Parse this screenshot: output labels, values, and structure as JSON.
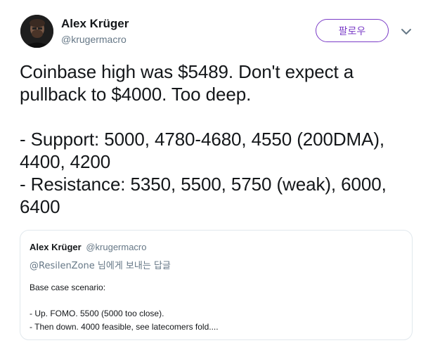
{
  "author": {
    "name": "Alex Krüger",
    "handle": "@krugermacro"
  },
  "follow_button": {
    "label": "팔로우"
  },
  "tweet": {
    "lines": [
      "Coinbase high was $5489. Don't expect a",
      "pullback to $4000. Too deep.",
      "",
      "- Support: 5000, 4780-4680, 4550 (200DMA),",
      "4400, 4200",
      "- Resistance: 5350, 5500, 5750 (weak), 6000,",
      "6400"
    ]
  },
  "quoted_tweet": {
    "author_name": "Alex Krüger",
    "author_handle": "@krugermacro",
    "reply_mention": "@ResilenZone",
    "reply_suffix": " 님에게 보내는 답글",
    "body_lines": [
      "Base case scenario:",
      "",
      "- Up. FOMO. 5500 (5000 too close).",
      "- Then down. 4000 feasible, see latecomers fold...."
    ]
  },
  "colors": {
    "accent": "#7b3cc7",
    "muted": "#657786",
    "text": "#14171a",
    "border": "#e1e8ed"
  },
  "icons": {
    "menu": "chevron-down-icon"
  }
}
